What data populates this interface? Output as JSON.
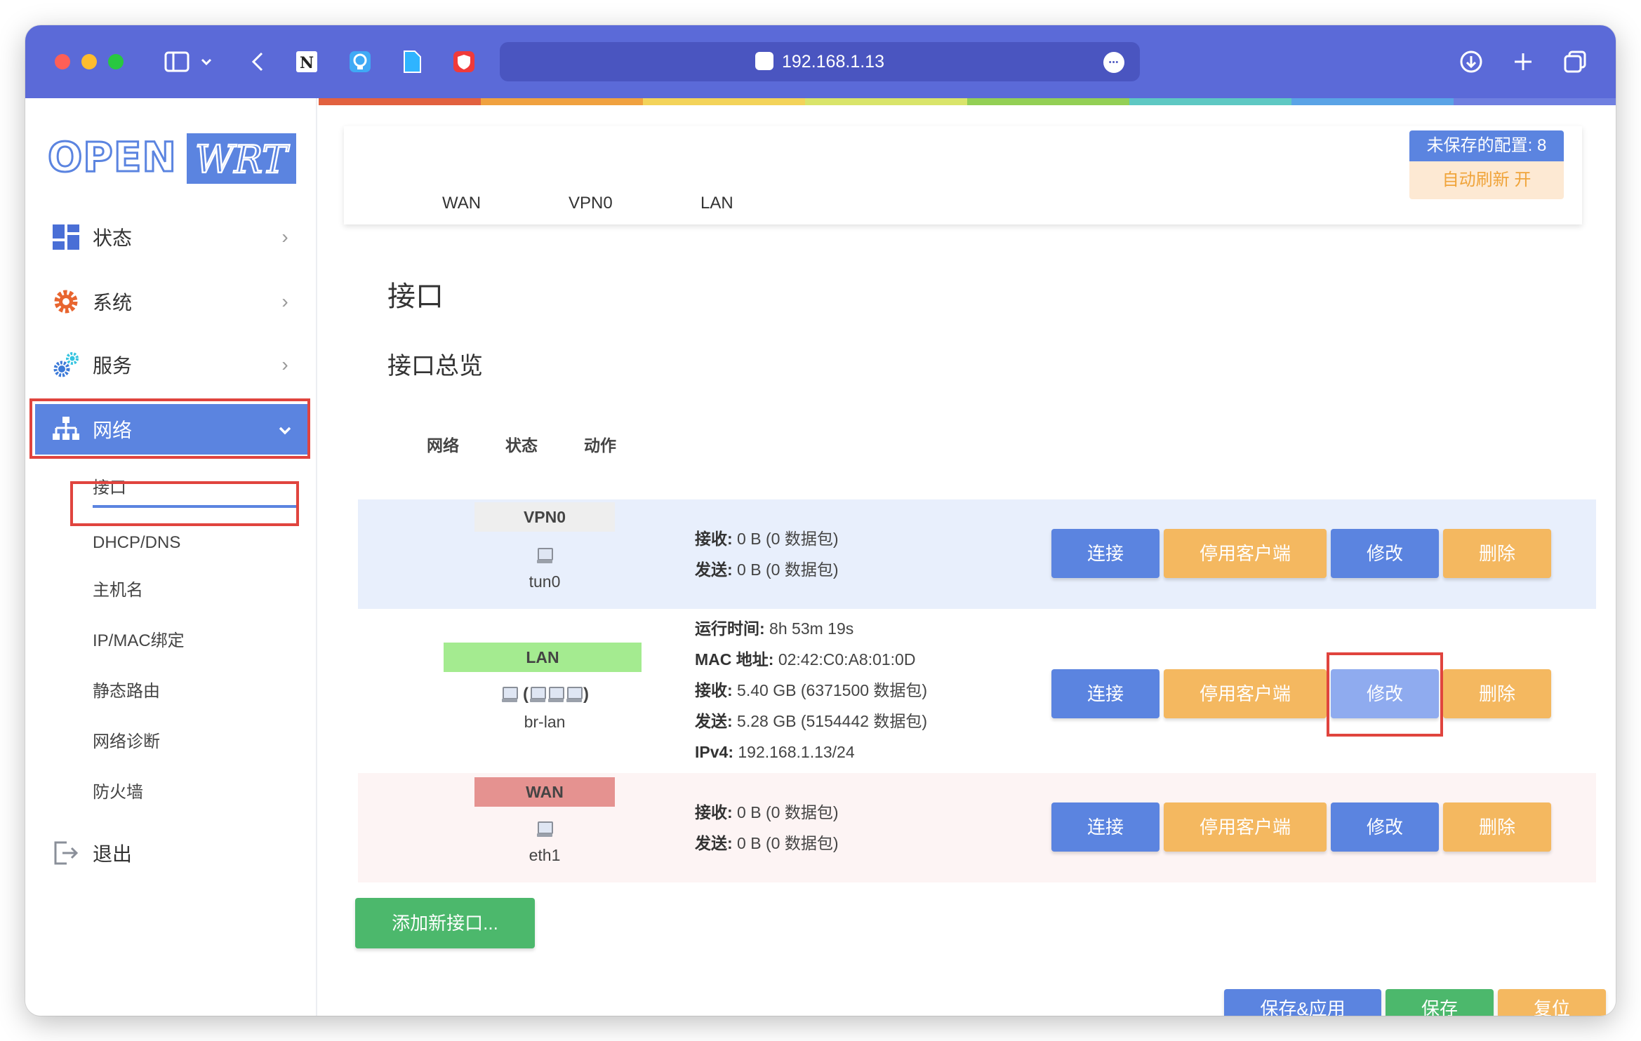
{
  "browser": {
    "url": "192.168.1.13"
  },
  "sidebar": {
    "logo_left": "OPEN",
    "logo_right": "WRT",
    "items": [
      {
        "label": "状态",
        "icon": "dashboard-icon"
      },
      {
        "label": "系统",
        "icon": "gear-icon"
      },
      {
        "label": "服务",
        "icon": "gears-icon"
      },
      {
        "label": "网络",
        "icon": "network-icon"
      },
      {
        "label": "退出",
        "icon": "logout-icon"
      }
    ],
    "network_sub": [
      "接口",
      "DHCP/DNS",
      "主机名",
      "IP/MAC绑定",
      "静态路由",
      "网络诊断",
      "防火墙"
    ]
  },
  "header": {
    "tabs": [
      "WAN",
      "VPN0",
      "LAN"
    ],
    "unsaved_label": "未保存的配置: 8",
    "auto_refresh": "自动刷新 开"
  },
  "main": {
    "title": "接口",
    "subtitle": "接口总览",
    "columns": [
      "网络",
      "状态",
      "动作"
    ],
    "interfaces": [
      {
        "name": "VPN0",
        "device": "tun0",
        "bridge": "",
        "lines": [
          {
            "k": "接收:",
            "v": " 0 B (0 数据包)"
          },
          {
            "k": "发送:",
            "v": " 0 B (0 数据包)"
          }
        ]
      },
      {
        "name": "LAN",
        "device": "br-lan",
        "bridge": "(",
        "bridge_end": ")",
        "lines": [
          {
            "k": "运行时间:",
            "v": " 8h 53m 19s"
          },
          {
            "k": "MAC 地址:",
            "v": " 02:42:C0:A8:01:0D"
          },
          {
            "k": "接收:",
            "v": " 5.40 GB (6371500 数据包)"
          },
          {
            "k": "发送:",
            "v": " 5.28 GB (5154442 数据包)"
          },
          {
            "k": "IPv4:",
            "v": " 192.168.1.13/24"
          }
        ]
      },
      {
        "name": "WAN",
        "device": "eth1",
        "bridge": "",
        "lines": [
          {
            "k": "接收:",
            "v": " 0 B (0 数据包)"
          },
          {
            "k": "发送:",
            "v": " 0 B (0 数据包)"
          }
        ]
      }
    ],
    "buttons": {
      "connect": "连接",
      "stop": "停用客户端",
      "edit": "修改",
      "delete": "删除"
    },
    "add_button": "添加新接口...",
    "footer_buttons": [
      "保存&应用",
      "保存",
      "复位"
    ]
  },
  "colors": {
    "titlebar": "#5b6ad8",
    "accent_blue": "#5b84e0",
    "accent_orange": "#f4b860",
    "highlight_red": "#e0443e",
    "vpn_tag": "#eeeeee",
    "lan_tag": "#a4eb90",
    "wan_tag": "#e59290",
    "rainbow": [
      "#e2613f",
      "#f0a13f",
      "#f3d35a",
      "#d9e46a",
      "#93cf55",
      "#5ec8c3",
      "#5aa3e6",
      "#6f7fe0"
    ]
  }
}
